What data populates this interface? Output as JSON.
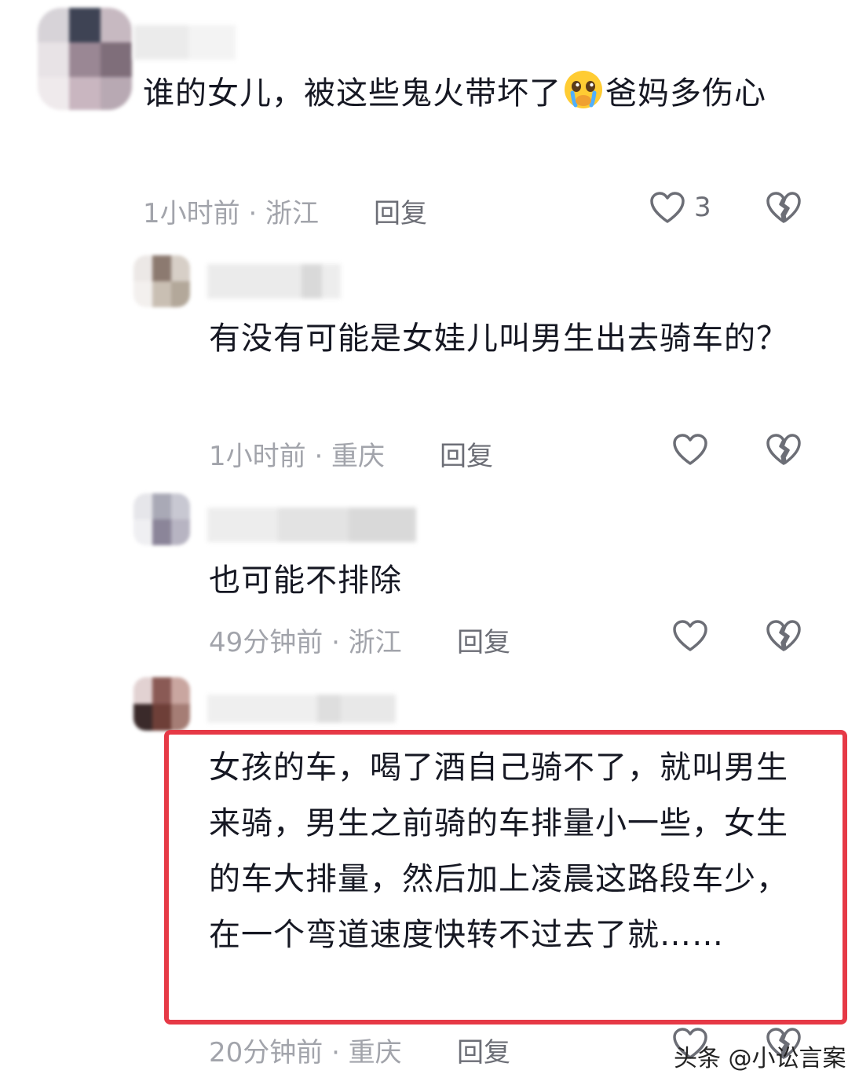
{
  "comments": [
    {
      "text_before_emoji": "谁的女儿，被这些鬼火带坏了",
      "emoji": "crying-face-emoji",
      "text_after_emoji": "爸妈多伤心",
      "time_location": "1小时前 · 浙江",
      "reply_label": "回复",
      "like_count": "3"
    },
    {
      "text": "有没有可能是女娃儿叫男生出去骑车的？",
      "time_location": "1小时前 · 重庆",
      "reply_label": "回复"
    },
    {
      "text": "也可能不排除",
      "time_location": "49分钟前 · 浙江",
      "reply_label": "回复"
    },
    {
      "text": "女孩的车，喝了酒自己骑不了，就叫男生来骑，男生之前骑的车排量小一些，女生的车大排量，然后加上凌晨这路段车少，在一个弯道速度快转不过去了就……",
      "time_location": "20分钟前 · 重庆",
      "reply_label": "回复"
    }
  ],
  "watermark": "头条 @小讼言案",
  "colors": {
    "highlight_border": "#e63946",
    "meta_text": "#a2a4ab",
    "body_text": "#161823"
  }
}
